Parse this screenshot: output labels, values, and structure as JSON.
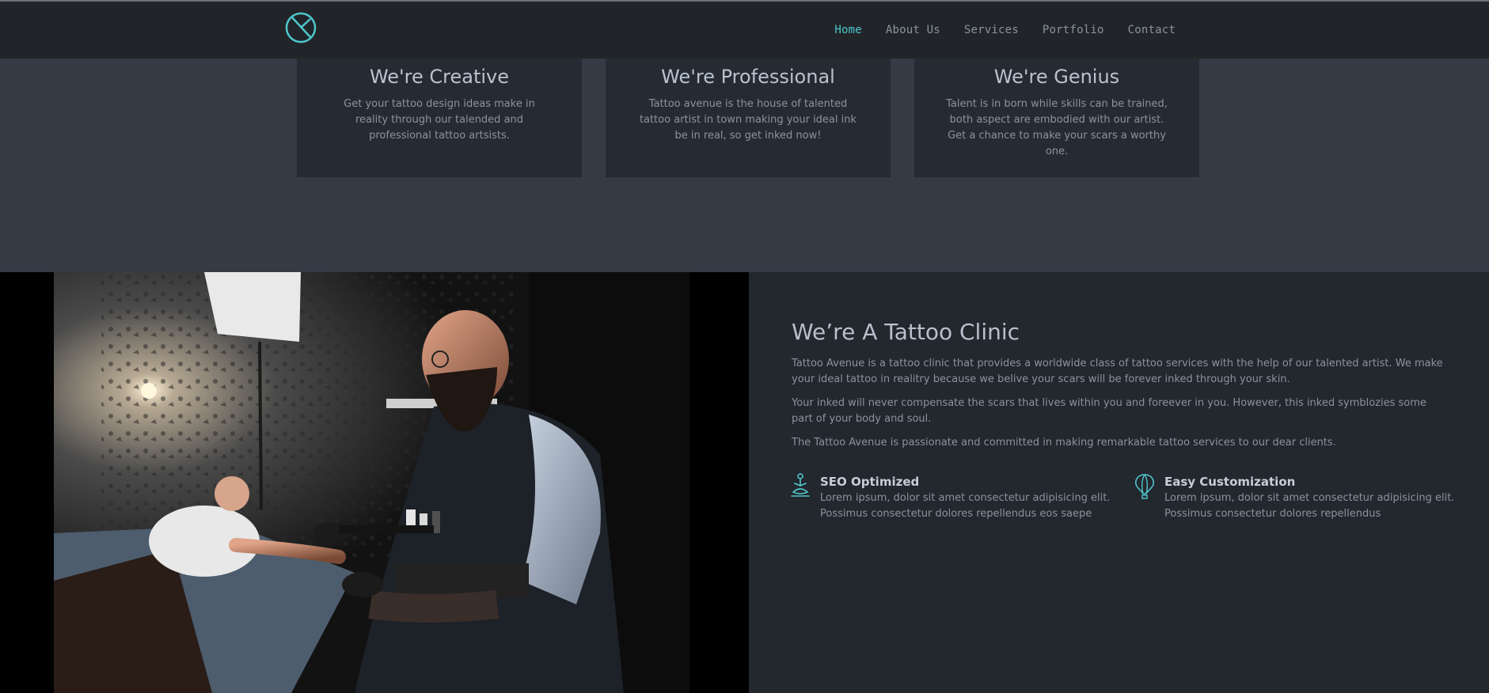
{
  "nav": {
    "items": [
      {
        "label": "Home",
        "active": true
      },
      {
        "label": "About Us"
      },
      {
        "label": "Services"
      },
      {
        "label": "Portfolio"
      },
      {
        "label": "Contact"
      }
    ]
  },
  "cards": [
    {
      "title": "We're Creative",
      "text": "Get your tattoo design ideas make in reality through our talended and professional tattoo artsists."
    },
    {
      "title": "We're Professional",
      "text": "Tattoo avenue is the house of talented tattoo artist in town making your ideal ink be in real, so get inked now!"
    },
    {
      "title": "We're Genius",
      "text": "Talent is in born while skills can be trained, both aspect are embodied with our artist. Get a chance to make your scars a worthy one."
    }
  ],
  "about": {
    "title": "We’re A Tattoo Clinic",
    "p1": "Tattoo Avenue is a tattoo clinic that provides a worldwide class of tattoo services with the help of our talented artist. We make your ideal tattoo in realitry because we belive your scars will be forever inked through your skin.",
    "p2": "Your inked will never compensate the scars that lives within you and foreever in you. However, this inked symblozies some part of your body and soul.",
    "p3": "The Tattoo Avenue is passionate and committed in making remarkable tattoo services to our dear clients."
  },
  "features": [
    {
      "title": "SEO Optimized",
      "text": "Lorem ipsum, dolor sit amet consectetur adipisicing elit. Possimus consectetur dolores repellendus eos saepe",
      "icon": "meditation-icon"
    },
    {
      "title": "Easy Customization",
      "text": "Lorem ipsum, dolor sit amet consectetur adipisicing elit. Possimus consectetur dolores repellendus",
      "icon": "hot-air-balloon-icon"
    }
  ],
  "colors": {
    "accent": "#4fc7cc",
    "navbar": "#212529",
    "card": "#262b33",
    "section": "#353b45",
    "clinic": "#23272e"
  }
}
